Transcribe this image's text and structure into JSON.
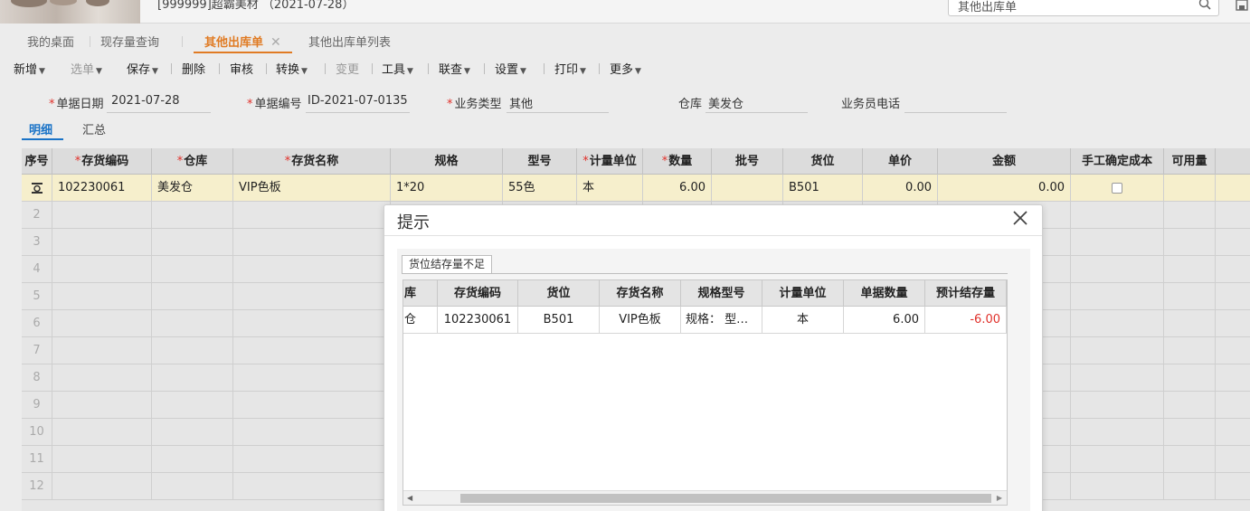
{
  "header": {
    "company": "[999999]超霸美材 （2021-07-28）",
    "search_value": "其他出库单"
  },
  "tabs": [
    {
      "label": "我的桌面"
    },
    {
      "label": "现存量查询"
    },
    {
      "label": "其他出库单",
      "active": true
    },
    {
      "label": "其他出库单列表"
    }
  ],
  "toolbar": {
    "add": "新增",
    "select": "选单",
    "save": "保存",
    "delete": "删除",
    "audit": "审核",
    "convert": "转换",
    "change": "变更",
    "tools": "工具",
    "link_query": "联查",
    "settings": "设置",
    "print": "打印",
    "more": "更多"
  },
  "form": {
    "doc_date_label": "单据日期",
    "doc_date": "2021-07-28",
    "doc_no_label": "单据编号",
    "doc_no": "ID-2021-07-0135",
    "biz_type_label": "业务类型",
    "biz_type": "其他",
    "warehouse_label": "仓库",
    "warehouse": "美发仓",
    "phone_label": "业务员电话",
    "phone": ""
  },
  "subtabs": {
    "detail": "明细",
    "summary": "汇总"
  },
  "grid": {
    "headers": {
      "seq": "序号",
      "code": "存货编码",
      "wh": "仓库",
      "name": "存货名称",
      "spec": "规格",
      "model": "型号",
      "unit": "计量单位",
      "qty": "数量",
      "batch": "批号",
      "loc": "货位",
      "price": "单价",
      "amount": "金额",
      "manual_cost": "手工确定成本",
      "available": "可用量"
    },
    "row1": {
      "code": "102230061",
      "wh": "美发仓",
      "name": "VIP色板",
      "spec": "1*20",
      "model": "55色",
      "unit": "本",
      "qty": "6.00",
      "loc": "B501",
      "price": "0.00",
      "amount": "0.00"
    },
    "row_numbers": [
      "2",
      "3",
      "4",
      "5",
      "6",
      "7",
      "8",
      "9",
      "10",
      "11",
      "12"
    ]
  },
  "modal": {
    "title": "提示",
    "tab": "货位结存量不足",
    "headers": {
      "wh": "库",
      "code": "存货编码",
      "loc": "货位",
      "name": "存货名称",
      "spec": "规格型号",
      "unit": "计量单位",
      "qty": "单据数量",
      "est": "预计结存量"
    },
    "row": {
      "wh": "仓",
      "code": "102230061",
      "loc": "B501",
      "name": "VIP色板",
      "spec": "规格：  型…",
      "unit": "本",
      "qty": "6.00",
      "est": "-6.00"
    }
  },
  "colors": {
    "accent_orange": "#e07b24",
    "link_blue": "#1a73c7",
    "required_red": "#e0302a",
    "row_highlight": "#f6efcc"
  }
}
